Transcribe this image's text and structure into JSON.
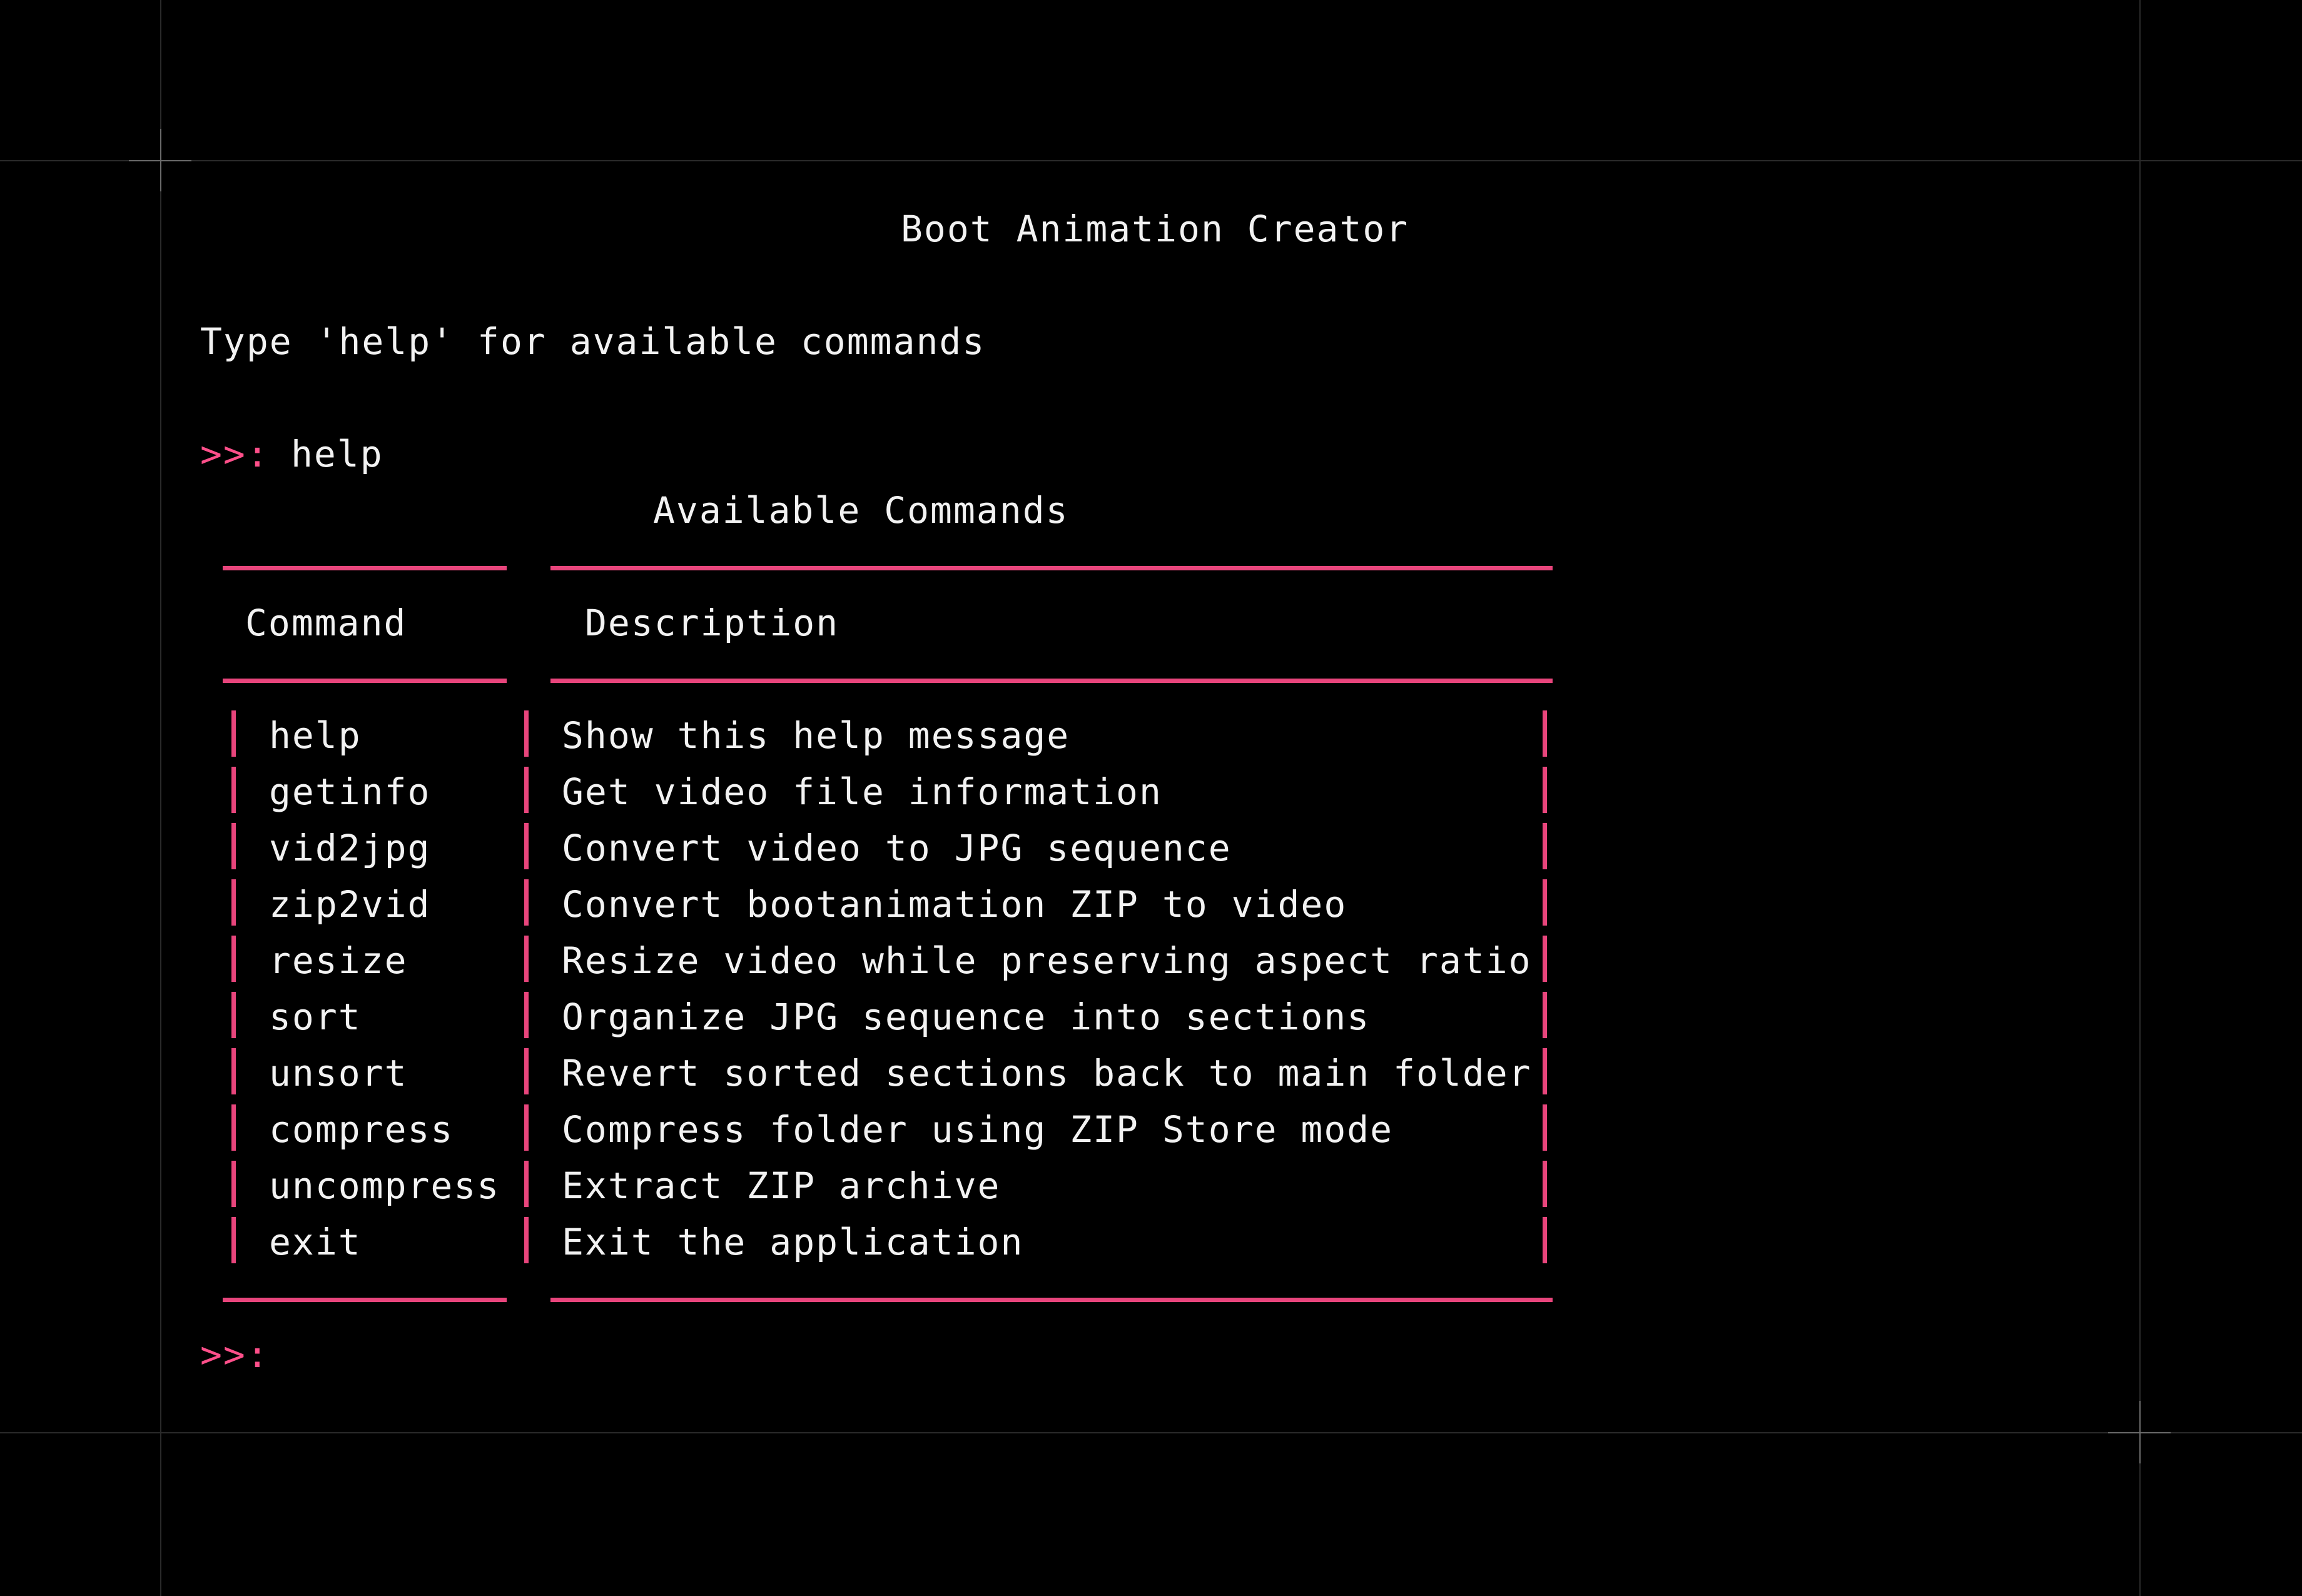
{
  "terminal": {
    "title": "Boot Animation Creator",
    "hint": "Type 'help' for available commands",
    "prompt": ">>:",
    "entered_command": "help",
    "table_title": "Available Commands",
    "table_headers": {
      "command": "Command",
      "description": "Description"
    },
    "rows": [
      {
        "command": "help",
        "description": "Show this help message"
      },
      {
        "command": "getinfo",
        "description": "Get video file information"
      },
      {
        "command": "vid2jpg",
        "description": "Convert video to JPG sequence"
      },
      {
        "command": "zip2vid",
        "description": "Convert bootanimation ZIP to video"
      },
      {
        "command": "resize",
        "description": "Resize video while preserving aspect ratio"
      },
      {
        "command": "sort",
        "description": "Organize JPG sequence into sections"
      },
      {
        "command": "unsort",
        "description": "Revert sorted sections back to main folder"
      },
      {
        "command": "compress",
        "description": "Compress folder using ZIP Store mode"
      },
      {
        "command": "uncompress",
        "description": "Extract ZIP archive"
      },
      {
        "command": "exit",
        "description": "Exit the application"
      }
    ],
    "final_prompt": ">>:"
  },
  "colors": {
    "background": "#000000",
    "text": "#f2f2f2",
    "accent": "#e8457c",
    "prompt": "#ff4f8a"
  }
}
